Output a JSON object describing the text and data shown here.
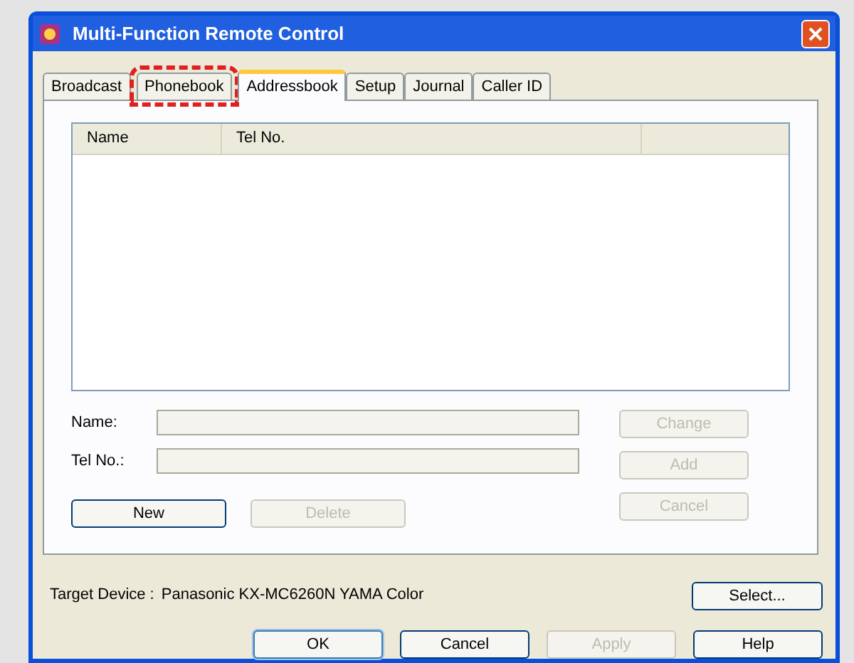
{
  "window": {
    "title": "Multi-Function Remote Control"
  },
  "tabs": [
    {
      "label": "Broadcast",
      "selected": false
    },
    {
      "label": "Phonebook",
      "selected": false,
      "marked": true
    },
    {
      "label": "Addressbook",
      "selected": true
    },
    {
      "label": "Setup",
      "selected": false
    },
    {
      "label": "Journal",
      "selected": false
    },
    {
      "label": "Caller ID",
      "selected": false
    }
  ],
  "list": {
    "columns": [
      "Name",
      "Tel No."
    ]
  },
  "fields": [
    {
      "label": "Name:",
      "button": {
        "label": "Change",
        "disabled": true
      }
    },
    {
      "label": "Tel No.:",
      "button": {
        "label": "Add",
        "disabled": true
      }
    }
  ],
  "row_buttons": [
    {
      "label": "New",
      "disabled": false
    },
    {
      "label": "Delete",
      "disabled": true
    }
  ],
  "side_cancel": {
    "label": "Cancel",
    "disabled": true
  },
  "target_device": {
    "label": "Target Device :",
    "value": "Panasonic KX-MC6260N YAMA Color"
  },
  "select_button": {
    "label": "Select...",
    "disabled": false
  },
  "dialog_buttons": [
    {
      "label": "OK",
      "disabled": false,
      "default": true
    },
    {
      "label": "Cancel",
      "disabled": false,
      "default": false
    },
    {
      "label": "Apply",
      "disabled": true,
      "default": false
    },
    {
      "label": "Help",
      "disabled": false,
      "default": false
    }
  ]
}
